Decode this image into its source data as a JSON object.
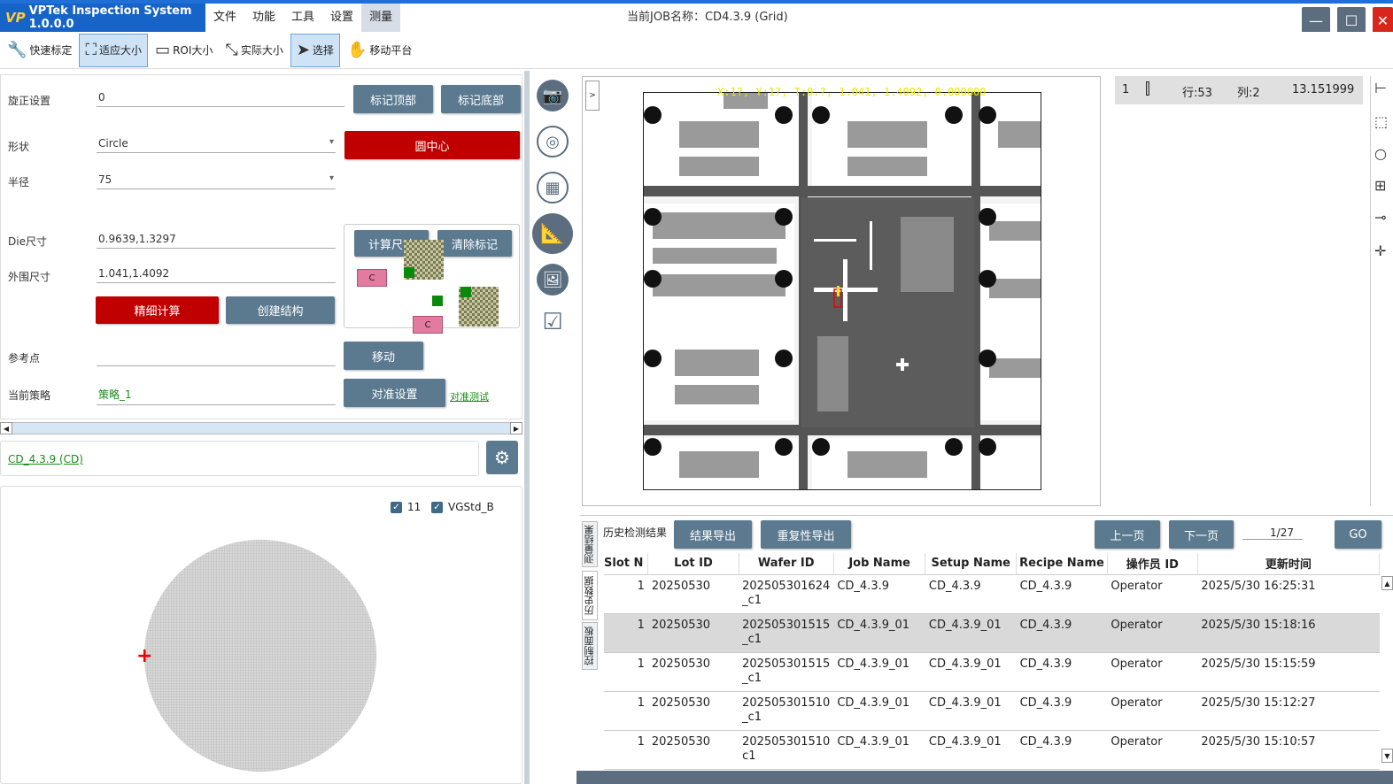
{
  "app": {
    "title": "VPTek Inspection System 1.0.0.0",
    "logo": "VP",
    "job_title": "当前JOB名称：CD4.3.9 (Grid)"
  },
  "menu": [
    "文件",
    "功能",
    "工具",
    "设置",
    "测量"
  ],
  "toolbar": {
    "quick_calib": "快速标定",
    "fit_size": "适应大小",
    "roi_size": "ROI大小",
    "actual_size": "实际大小",
    "select": "选择",
    "move_stage": "移动平台"
  },
  "form": {
    "rotate_label": "旋正设置",
    "rotate_value": "0",
    "mark_top": "标记顶部",
    "mark_bottom": "标记底部",
    "shape_label": "形状",
    "shape_value": "Circle",
    "circle_center": "圆中心",
    "radius_label": "半径",
    "radius_value": "75",
    "calc_size": "计算尺寸",
    "clear_marks": "清除标记",
    "die_label": "Die尺寸",
    "die_value": "0.9639,1.3297",
    "outer_label": "外围尺寸",
    "outer_value": "1.041,1.4092",
    "fine_calc": "精细计算",
    "create_struct": "创建结构",
    "ref_label": "参考点",
    "ref_value": "",
    "move": "移动",
    "strategy_label": "当前策略",
    "strategy_value": "策略_1",
    "align_settings": "对准设置",
    "align_test": "对准测试",
    "struct_c": "C"
  },
  "recipe": {
    "link": "CD_4.3.9 (CD)"
  },
  "wafer": {
    "check1": "11",
    "check2": "VGStd_B"
  },
  "image": {
    "coord_text": "X:1?, Y:1?, T:0.?, 1.041, 1.4092, 0.000000",
    "collapse": ">"
  },
  "measure": {
    "index": "1",
    "row": "行:53",
    "col": "列:2",
    "value": "13.151999"
  },
  "history": {
    "tabs": [
      "测量结果",
      "历史数据",
      "控制面板"
    ],
    "label": "历史检测结果",
    "export_results": "结果导出",
    "export_repeat": "重复性导出",
    "prev_page": "上一页",
    "next_page": "下一页",
    "page": "1/27",
    "go": "GO",
    "columns": [
      "Slot N",
      "Lot ID",
      "Wafer ID",
      "Job Name",
      "Setup Name",
      "Recipe Name",
      "操作员 ID",
      "更新时间"
    ],
    "rows": [
      {
        "slot": "1",
        "lot": "20250530",
        "wafer1": "202505301624",
        "wafer2": "_c1",
        "job": "CD_4.3.9",
        "setup": "CD_4.3.9",
        "recipe": "CD_4.3.9",
        "op": "Operator",
        "time": "2025/5/30 16:25:31"
      },
      {
        "slot": "1",
        "lot": "20250530",
        "wafer1": "202505301515",
        "wafer2": "_c1",
        "job": "CD_4.3.9_01",
        "setup": "CD_4.3.9_01",
        "recipe": "CD_4.3.9",
        "op": "Operator",
        "time": "2025/5/30 15:18:16"
      },
      {
        "slot": "1",
        "lot": "20250530",
        "wafer1": "202505301515",
        "wafer2": "_c1",
        "job": "CD_4.3.9_01",
        "setup": "CD_4.3.9_01",
        "recipe": "CD_4.3.9",
        "op": "Operator",
        "time": "2025/5/30 15:15:59"
      },
      {
        "slot": "1",
        "lot": "20250530",
        "wafer1": "202505301510",
        "wafer2": "_c1",
        "job": "CD_4.3.9_01",
        "setup": "CD_4.3.9_01",
        "recipe": "CD_4.3.9",
        "op": "Operator",
        "time": "2025/5/30 15:12:27"
      },
      {
        "slot": "1",
        "lot": "20250530",
        "wafer1": "202505301510",
        "wafer2": "c1",
        "job": "CD_4.3.9_01",
        "setup": "CD_4.3.9_01",
        "recipe": "CD_4.3.9",
        "op": "Operator",
        "time": "2025/5/30 15:10:57"
      }
    ]
  },
  "colors": {
    "title_blue": "#1664c8",
    "button_slate": "#5b7a90",
    "accent_red": "#c00000",
    "link_green": "#1a8a1a"
  }
}
